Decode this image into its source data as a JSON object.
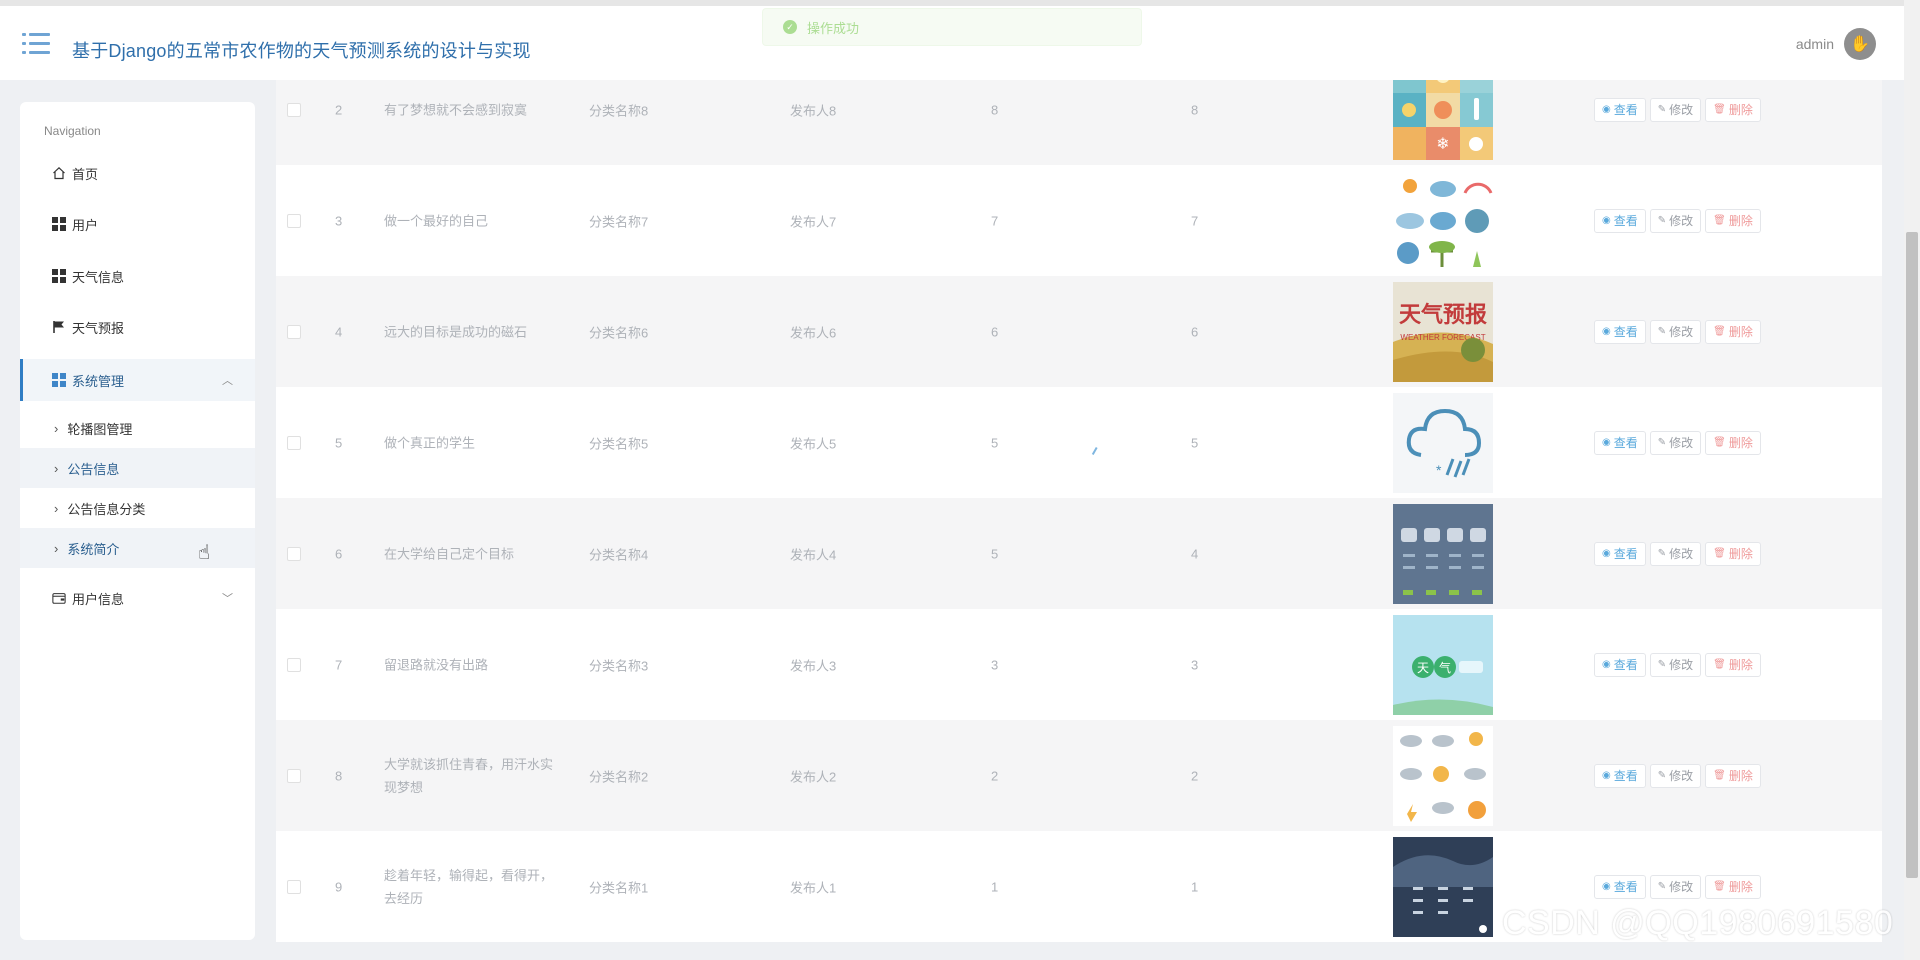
{
  "header": {
    "title": "基于Django的五常市农作物的天气预测系统的设计与实现",
    "user": "admin",
    "toast": "操作成功"
  },
  "sidebar": {
    "heading": "Navigation",
    "items": [
      {
        "label": "首页",
        "icon": "home-icon"
      },
      {
        "label": "用户",
        "icon": "grid-icon"
      },
      {
        "label": "天气信息",
        "icon": "grid-icon"
      },
      {
        "label": "天气预报",
        "icon": "flag-icon"
      },
      {
        "label": "系统管理",
        "icon": "grid-icon",
        "expanded": true
      },
      {
        "label": "用户信息",
        "icon": "wallet-icon",
        "expanded": false
      }
    ],
    "sub_items": [
      {
        "label": "轮播图管理"
      },
      {
        "label": "公告信息"
      },
      {
        "label": "公告信息分类"
      },
      {
        "label": "系统简介"
      }
    ]
  },
  "table": {
    "actions": {
      "view": "查看",
      "edit": "修改",
      "delete": "删除"
    },
    "rows": [
      {
        "id": "2",
        "title": "有了梦想就不会感到寂寞",
        "category": "分类名称8",
        "publisher": "发布人8",
        "n1": "8",
        "n2": "8",
        "thumb": "weather-icons-grid"
      },
      {
        "id": "3",
        "title": "做一个最好的自己",
        "category": "分类名称7",
        "publisher": "发布人7",
        "n1": "7",
        "n2": "7",
        "thumb": "weather-icons-set"
      },
      {
        "id": "4",
        "title": "远大的目标是成功的磁石",
        "category": "分类名称6",
        "publisher": "发布人6",
        "n1": "6",
        "n2": "6",
        "thumb": "weather-forecast-banner",
        "thumb_text": "天气预报",
        "thumb_subtext": "WEATHER FORECAST"
      },
      {
        "id": "5",
        "title": "做个真正的学生",
        "category": "分类名称5",
        "publisher": "发布人5",
        "n1": "5",
        "n2": "5",
        "thumb": "snow-cloud"
      },
      {
        "id": "6",
        "title": "在大学给自己定个目标",
        "category": "分类名称4",
        "publisher": "发布人4",
        "n1": "5",
        "n2": "4",
        "thumb": "forecast-panel"
      },
      {
        "id": "7",
        "title": "留退路就没有出路",
        "category": "分类名称3",
        "publisher": "发布人3",
        "n1": "3",
        "n2": "3",
        "thumb": "weather-app-banner"
      },
      {
        "id": "8",
        "title": "大学就该抓住青春，用汗水实现梦想",
        "category": "分类名称2",
        "publisher": "发布人2",
        "n1": "2",
        "n2": "2",
        "thumb": "weather-icons-sketch"
      },
      {
        "id": "9",
        "title": "趁着年轻，输得起，看得开，去经历",
        "category": "分类名称1",
        "publisher": "发布人1",
        "n1": "1",
        "n2": "1",
        "thumb": "phone-weather-screen"
      }
    ]
  },
  "watermark": "CSDN @QQ1980691580"
}
